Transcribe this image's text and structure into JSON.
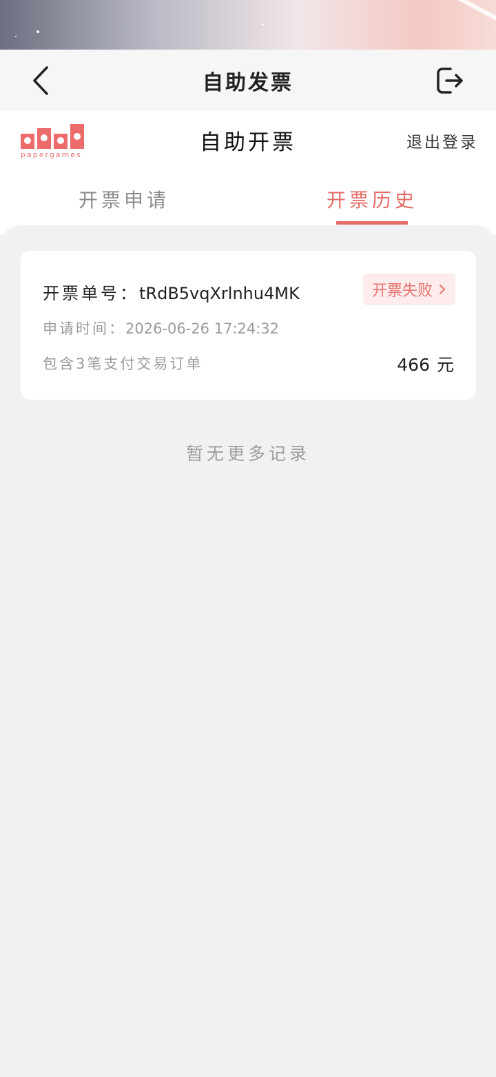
{
  "topbar": {
    "title": "自助发票"
  },
  "header": {
    "logo_text": "papergames",
    "title": "自助开票",
    "logout_label": "退出登录"
  },
  "tabs": [
    {
      "label": "开票申请",
      "active": false
    },
    {
      "label": "开票历史",
      "active": true
    }
  ],
  "records": [
    {
      "order_label": "开票单号：",
      "order_no": "tRdB5vqXrlnhu4MK",
      "status": "开票失败",
      "time_label": "申请时间：",
      "time": "2026-06-26 17:24:32",
      "summary": "包含3笔支付交易订单",
      "amount": "466",
      "amount_unit": "元"
    }
  ],
  "empty_hint": "暂无更多记录",
  "colors": {
    "accent": "#e56b66",
    "badge_bg": "#fdeceb",
    "page_bg": "#f0f1f3"
  }
}
